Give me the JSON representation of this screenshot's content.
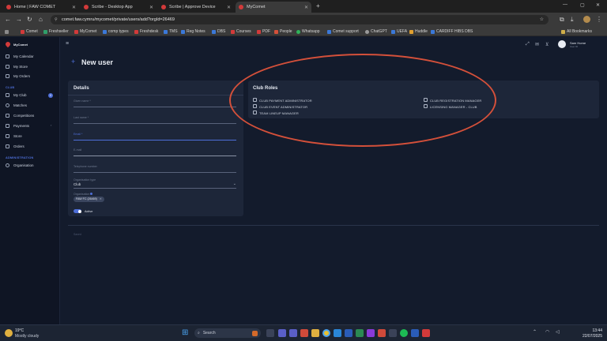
{
  "browser": {
    "tabs": [
      {
        "label": "Home | FAW COMET"
      },
      {
        "label": "Scribe - Desktop App"
      },
      {
        "label": "Scribe | Approve Device"
      },
      {
        "label": "MyComet"
      }
    ],
    "new_tab": "+",
    "url": "comet.faw.cymru/mycomet/private/users/add?orgId=26469",
    "bookmarks": [
      "Comet",
      "Freshseller",
      "MyComet",
      "comp types",
      "Freshdesk",
      "TMS",
      "Reg Notes",
      "DBS",
      "Courses",
      "PDF",
      "People",
      "Whatsapp",
      "Comet support",
      "ChatGPT",
      "UEFA",
      "Huddle",
      "CARDIFF HIBS DBS"
    ],
    "all_bookmarks": "All Bookmarks",
    "colors": {
      "tab_favicon": "#d23a3a"
    }
  },
  "app": {
    "logo_text": "MyComet",
    "user": {
      "name": "Sam Horne",
      "sub": "User ID"
    },
    "sidebar": {
      "items_top": [
        "My Calendar",
        "My Store",
        "My Orders"
      ],
      "section_club": "CLUB",
      "items_club": [
        "My Club",
        "Matches",
        "Competitions",
        "Payments",
        "Store",
        "Orders"
      ],
      "my_club_badge": "0",
      "section_admin": "ADMINISTRATION",
      "items_admin": [
        "Organisation"
      ]
    },
    "page_title": "New user",
    "details": {
      "title": "Details",
      "fields": [
        "Given name *",
        "Last name *",
        "Email *",
        "E-mail",
        "Telephone number"
      ],
      "org_type_label": "Organisation type",
      "org_type_value": "Club",
      "organisation_label": "Organisation",
      "organisation_chip": "FAW FC (26469)",
      "active_label": "Active"
    },
    "club_roles": {
      "title": "Club Roles",
      "roles_left": [
        "CLUB PAYMENT ADMINISTRATOR",
        "CLUB EVENT ADMINISTRATOR",
        "TEAM LINEUP MANAGER"
      ],
      "roles_right": [
        "CLUB REGISTRATION MANAGER",
        "LICENSING MANAGER - CLUB"
      ]
    },
    "footer_text": "Saved",
    "colors": {
      "accent": "#4e6fd8",
      "highlight": "#d4503a",
      "background": "#131b2c",
      "panel": "#1d2639"
    }
  },
  "taskbar": {
    "weather": {
      "temp": "19°C",
      "desc": "Mostly cloudy"
    },
    "search_placeholder": "Search",
    "time": "13:44",
    "date": "22/07/2025"
  }
}
